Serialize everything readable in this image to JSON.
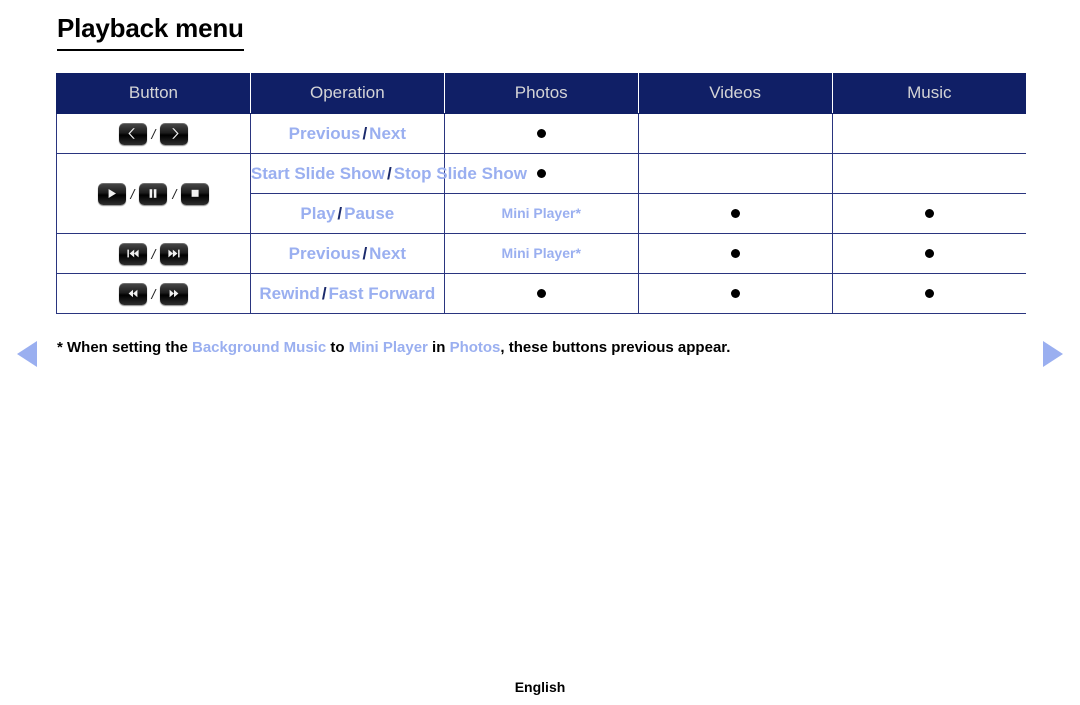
{
  "page": {
    "title": "Playback menu",
    "language": "English"
  },
  "table": {
    "headers": [
      {
        "key": "button",
        "label": "Button"
      },
      {
        "key": "operation",
        "label": "Operation"
      },
      {
        "key": "photos",
        "label": "Photos"
      },
      {
        "key": "videos",
        "label": "Videos"
      },
      {
        "key": "music",
        "label": "Music"
      }
    ],
    "rows": [
      {
        "buttons": [
          "chevron-left",
          "chevron-right"
        ],
        "operation": {
          "left": "Previous",
          "sep": "/",
          "right": "Next"
        },
        "photos": "dot",
        "videos": "",
        "music": ""
      },
      {
        "buttons": [
          "play",
          "pause",
          "stop"
        ],
        "operation": {
          "left": "Start Slide Show",
          "sep": "/",
          "right": "Stop Slide Show"
        },
        "photos": "dot",
        "videos": "",
        "music": ""
      },
      {
        "buttons": [],
        "operation": {
          "left": "Play",
          "sep": "/",
          "right": "Pause"
        },
        "photos": "Mini Player*",
        "videos": "dot",
        "music": "dot"
      },
      {
        "buttons": [
          "skip-previous",
          "skip-next"
        ],
        "operation": {
          "left": "Previous",
          "sep": "/",
          "right": "Next"
        },
        "photos": "Mini Player*",
        "videos": "dot",
        "music": "dot"
      },
      {
        "buttons": [
          "rewind",
          "fast-forward"
        ],
        "operation": {
          "left": "Rewind",
          "sep": "/",
          "right": "Fast Forward"
        },
        "photos": "dot",
        "videos": "dot",
        "music": "dot"
      }
    ]
  },
  "footnote": {
    "part1": "* When setting the ",
    "link1": "Background Music",
    "part2": " to ",
    "link2": "Mini Player",
    "part3": " in ",
    "link3": "Photos",
    "part4": ", these buttons previous appear."
  },
  "navigation": {
    "prev_label": "previous-page-arrow",
    "next_label": "next-page-arrow"
  },
  "colors": {
    "header_bg": "#101f66",
    "header_text": "#d4d4d6",
    "accent_text": "#9aaff0",
    "border": "#2a357f",
    "dot": "#000000"
  }
}
